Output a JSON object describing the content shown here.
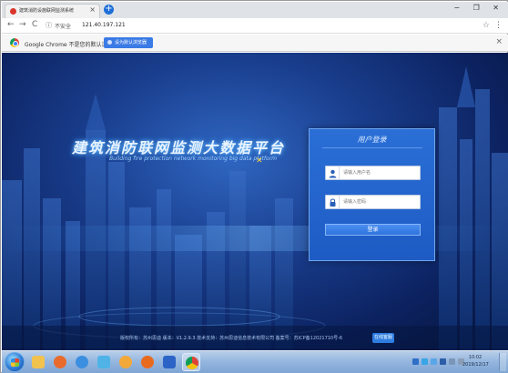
{
  "browser": {
    "tab_title": "建筑消防设施联网监测系统",
    "tab_close": "×",
    "new_tab": "+",
    "window_controls": "− ❐ ✕",
    "nav": {
      "back": "←",
      "forward": "→",
      "reload": "C"
    },
    "security_label": "不安全",
    "url": "121.40.197.121",
    "star": "☆",
    "menu": "⋮",
    "infobar": {
      "text": "Google Chrome 不是您的默认浏览器",
      "button": "设为默认浏览器",
      "close": "×"
    }
  },
  "page": {
    "hero_title": "建筑消防联网监测大数据平台",
    "hero_subtitle": "Building fire protection network monitoring big data platform",
    "cursor": "✕",
    "login": {
      "title": "用户登录",
      "username_placeholder": "请输入用户名",
      "password_placeholder": "请输入密码",
      "submit": "登录",
      "user_icon": "user-icon",
      "lock_icon": "lock-icon"
    },
    "footer": {
      "text": "版权所有：苏州思迪    版本：V1.2.9.3    技术支持：苏州思迪信息技术有限公司    备案号：苏ICP备12021710号-6",
      "button": "在线客服"
    }
  },
  "taskbar": {
    "time": "10:02",
    "date": "2019/12/17",
    "colors": {
      "explorer": "#f2c24e",
      "media": "#e86b2d",
      "app3": "#3b8fe0",
      "chat": "#4fb3e8",
      "app5": "#f3a83a",
      "firefox": "#e86a1f",
      "app7": "#2b64c6",
      "app8": "#5da0e0",
      "chrome": "#e04a3c"
    }
  }
}
